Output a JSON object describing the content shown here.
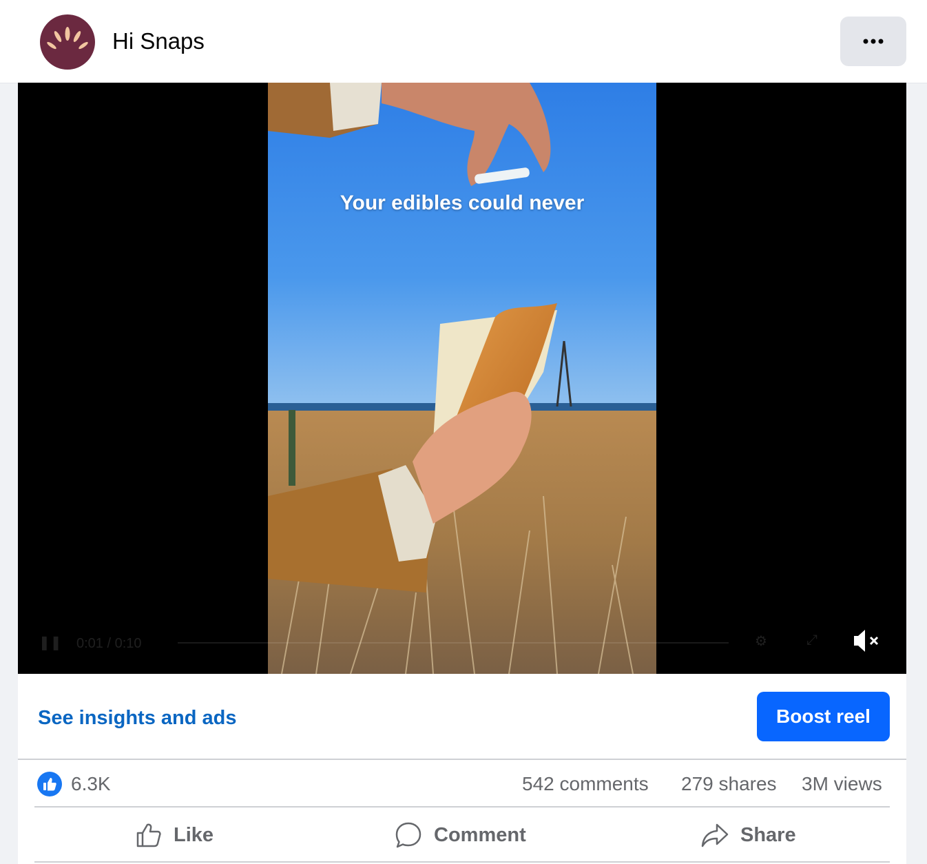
{
  "header": {
    "page_name": "Hi Snaps",
    "avatar_color": "#6b2940",
    "more_label": "•••"
  },
  "video": {
    "caption": "Your edibles could never",
    "controls": {
      "time": "0:01 / 0:10",
      "play_state_icon": "pause-icon",
      "mute_icon": "muted-speaker-icon",
      "settings_icon": "gear-icon",
      "fullscreen_icon": "expand-icon"
    }
  },
  "insights": {
    "link_label": "See insights and ads",
    "boost_label": "Boost reel",
    "boost_color": "#0866ff"
  },
  "stats": {
    "reactions": "6.3K",
    "comments": "542 comments",
    "shares": "279 shares",
    "views": "3M views"
  },
  "actions": {
    "like": "Like",
    "comment": "Comment",
    "share": "Share"
  }
}
